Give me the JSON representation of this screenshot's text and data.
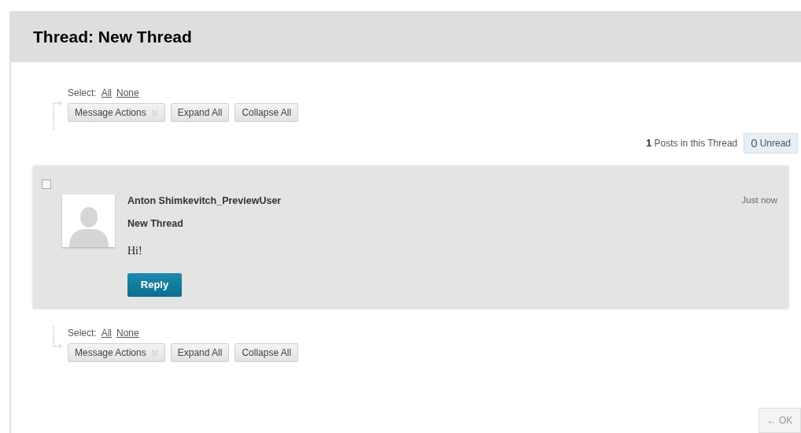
{
  "title": "Thread: New Thread",
  "toolbars": [
    {
      "kind": "top",
      "select_label": "Select:",
      "links": [
        "All",
        "None"
      ],
      "buttons": [
        {
          "label": "Message Actions",
          "kind": "dropdown"
        },
        {
          "label": "Expand All",
          "kind": "plain"
        },
        {
          "label": "Collapse All",
          "kind": "plain"
        }
      ]
    },
    {
      "kind": "bottom",
      "select_label": "Select:",
      "links": [
        "All",
        "None"
      ],
      "buttons": [
        {
          "label": "Message Actions",
          "kind": "dropdown"
        },
        {
          "label": "Expand All",
          "kind": "plain"
        },
        {
          "label": "Collapse All",
          "kind": "plain"
        }
      ]
    }
  ],
  "thread_stats": {
    "posts_count": "1",
    "posts_label": "Posts in this Thread",
    "unread_count": "0",
    "unread_label": "Unread"
  },
  "posts": [
    {
      "checked": false,
      "author": "Anton Shimkevitch_PreviewUser",
      "subject": "New Thread",
      "time": "Just now",
      "body": "Hi!",
      "reply_button": "Reply"
    }
  ],
  "ok_button": "← OK"
}
